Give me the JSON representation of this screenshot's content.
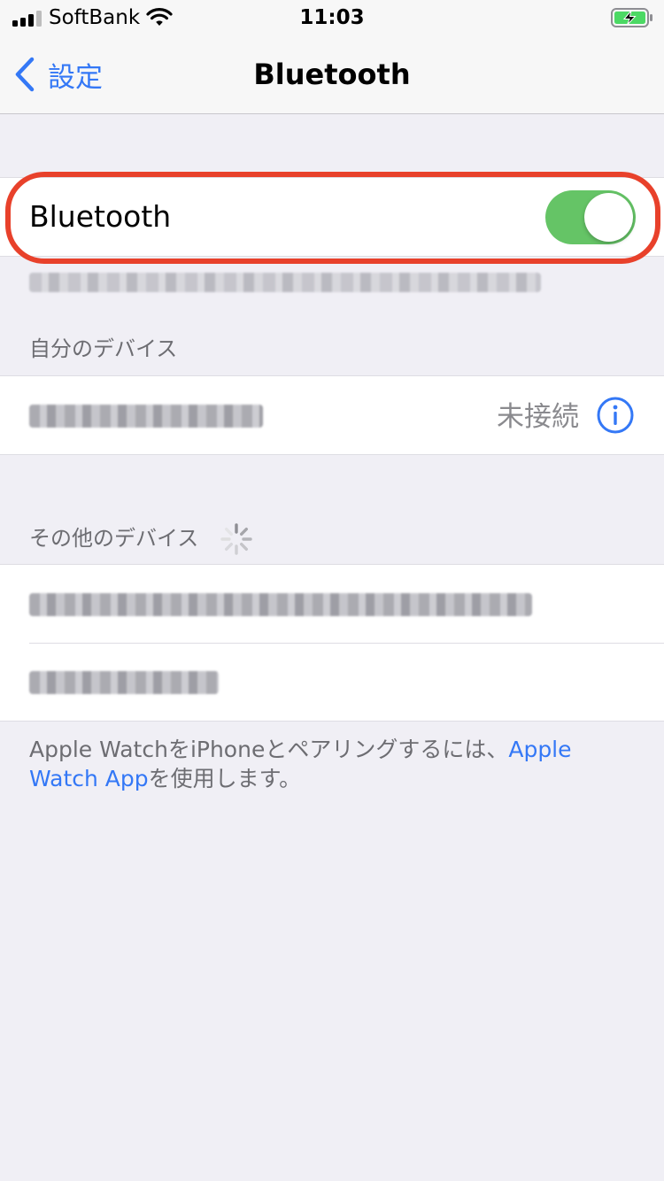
{
  "status_bar": {
    "carrier": "SoftBank",
    "time": "11:03",
    "signal_bars_active": 3,
    "signal_bars_total": 4,
    "wifi_icon": "wifi-icon",
    "battery_icon": "battery-charging-icon",
    "battery_color": "#4cd964"
  },
  "nav": {
    "back_label": "設定",
    "back_icon": "chevron-left-icon",
    "title": "Bluetooth"
  },
  "bluetooth_toggle": {
    "label": "Bluetooth",
    "on": true,
    "on_color": "#65c466",
    "highlight_color": "#e8412b"
  },
  "my_devices": {
    "header": "自分のデバイス",
    "items": [
      {
        "status": "未接続",
        "info_icon": "info-circle-icon"
      }
    ]
  },
  "other_devices": {
    "header": "その他のデバイス",
    "spinner_icon": "loading-spinner-icon"
  },
  "footer": {
    "text_before": "Apple WatchをiPhoneとペアリングするには、",
    "link": "Apple Watch App",
    "text_after": "を使用します。"
  },
  "colors": {
    "accent": "#3478f6",
    "background": "#f0eff5",
    "secondary_text": "#6d6d72"
  }
}
